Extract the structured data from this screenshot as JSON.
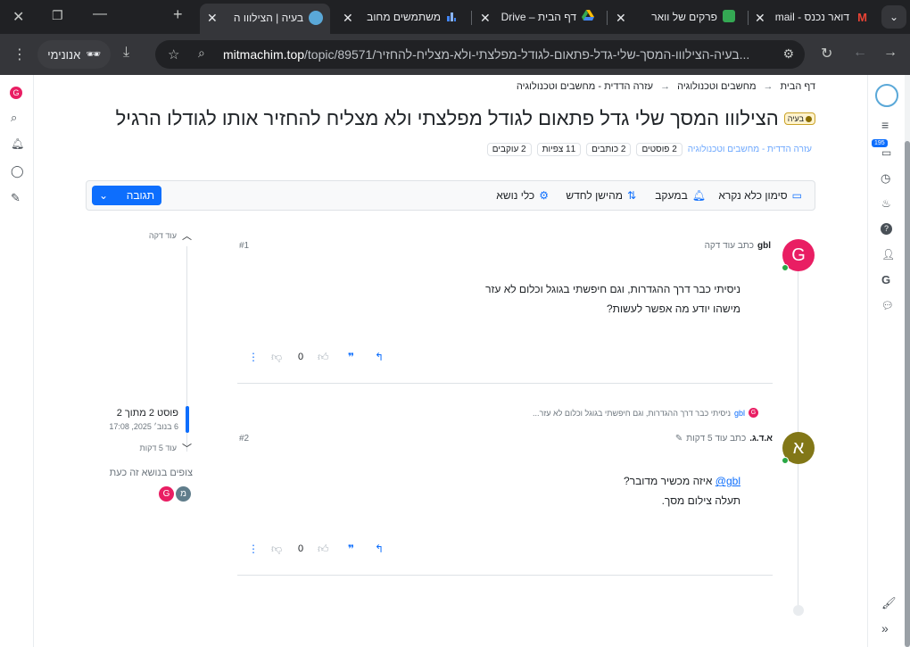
{
  "browser": {
    "tabs": [
      {
        "title": "דואר נכנס - mail",
        "icon": "gmail-icon"
      },
      {
        "title": "פרקים של וואר",
        "icon": "chat-icon"
      },
      {
        "title": "דף הבית – Drive",
        "icon": "drive-icon"
      },
      {
        "title": "משתמשים מחוב",
        "icon": "chart-icon"
      },
      {
        "title": "בעיה | הצילווו ה",
        "icon": "mitmachim-icon",
        "active": true
      }
    ],
    "url_host": "mitmachim.top",
    "url_path": "/topic/89571/בעיה-הצילווו-המסך-שלי-גדל-פתאום-לגודל-מפלצתי-ולא-מצליח-להחזיר...",
    "incognito_label": "אנונימי"
  },
  "breadcrumb": {
    "home": "דף הבית",
    "level1": "עזרה הדדית - מחשבים וטכנולוגיה",
    "level2": "מחשבים וטכנולוגיה",
    "separator": "→"
  },
  "topic": {
    "title": "הצילווו המסך שלי גדל פתאום לגודל מפלצתי ולא מצליח להחזיר אותו לגודלו הרגיל",
    "tag": "בעיה",
    "category": "עזרה הדדית - מחשבים וטכנולוגיה",
    "stats": [
      "2 פוסטים",
      "2 כותבים",
      "11 צפיות",
      "2 עוקבים"
    ]
  },
  "toolbar": {
    "mark_read": "סימון כלא נקרא",
    "watching": "במעקב",
    "sort": "מהישן לחדש",
    "tools": "כלי נושא",
    "reply": "תגובה"
  },
  "posts": [
    {
      "avatar_letter": "G",
      "avatar_color": "#e91e63",
      "author": "gbl",
      "meta": "כתב עוד דקה",
      "index": "#1",
      "lines": [
        "ניסיתי כבר דרך ההגדרות, וגם חיפשתי בגוגל וכלום לא עזר",
        "מישהו יודע מה אפשר לעשות?"
      ],
      "votes": "0"
    },
    {
      "avatar_letter": "א",
      "avatar_color": "#827717",
      "author": "א.ד.ג.",
      "meta": "כתב עוד 5 דקות",
      "index": "#2",
      "quote_user": "gbl",
      "quote_text": "ניסיתי כבר דרך ההגדרות, וגם חיפשתי בגוגל וכלום לא עזר...",
      "mention": "@gbl",
      "line1_rest": " איזה מכשיר מדובר?",
      "line2": "תעלה צילום מסך.",
      "votes": "0"
    }
  ],
  "timeline": {
    "top_time": "עוד דקה",
    "position": "פוסט 2 מתוך 2",
    "date": "6 בנוב׳ 2025, 17:08",
    "bottom_time": "עוד 5 דקות",
    "viewers_label": "צופים בנושא זה כעת"
  },
  "sidebar_right": {
    "notifications_badge": "195"
  },
  "colors": {
    "accent": "#0d6efd",
    "tag_bg": "#fff3cd",
    "online": "#28a745"
  }
}
